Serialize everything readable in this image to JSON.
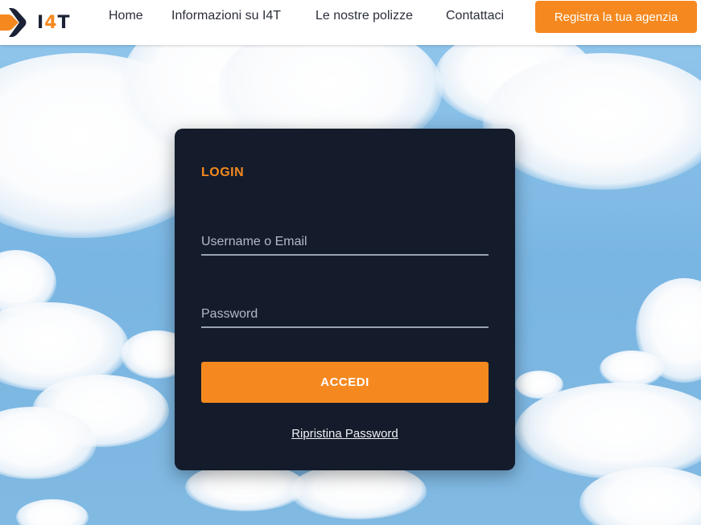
{
  "header": {
    "logo": {
      "icon": "i4t-chevron-logo-icon",
      "text_main": "I",
      "text_accent": "4",
      "text_end": "T"
    },
    "nav": [
      {
        "label": "Home"
      },
      {
        "label": "Informazioni su I4T"
      },
      {
        "label": "Le nostre polizze"
      },
      {
        "label": "Contattaci"
      }
    ],
    "cta_label": "Registra la tua agenzia"
  },
  "login": {
    "title": "LOGIN",
    "username_placeholder": "Username o Email",
    "username_value": "",
    "password_placeholder": "Password",
    "password_value": "",
    "submit_label": "ACCEDI",
    "reset_label": "Ripristina Password"
  },
  "colors": {
    "accent": "#f5891f",
    "card_background": "#141c2b",
    "header_background": "#ffffff",
    "sky": "#7ab6e3"
  }
}
